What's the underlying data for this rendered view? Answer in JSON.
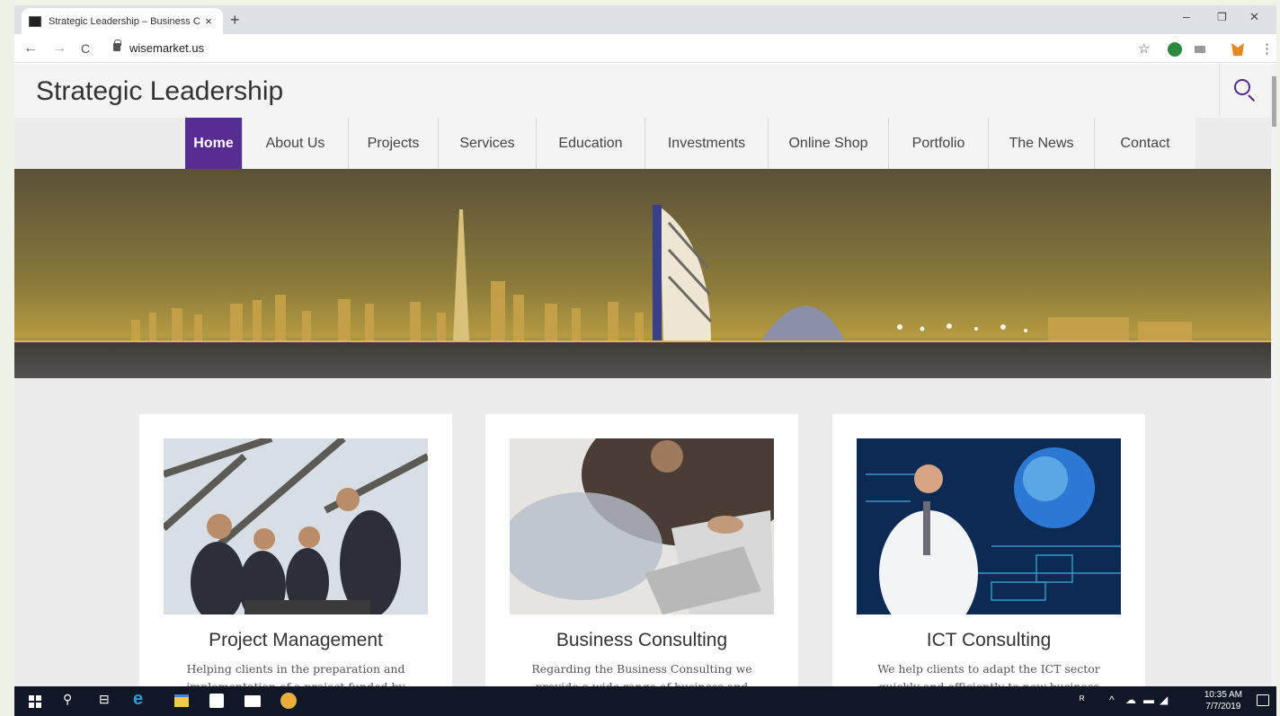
{
  "browser": {
    "tab_title": "Strategic Leadership – Business C",
    "tab_close": "×",
    "new_tab": "+",
    "window_controls": {
      "minimize": "–",
      "restore": "❐",
      "close": "✕"
    },
    "url": "wisemarket.us",
    "back": "←",
    "forward": "→",
    "reload": "C",
    "star": "☆",
    "menu": "⋮"
  },
  "site": {
    "title": "Strategic Leadership",
    "nav": [
      {
        "label": "Home",
        "active": true
      },
      {
        "label": "About Us"
      },
      {
        "label": "Projects"
      },
      {
        "label": "Services"
      },
      {
        "label": "Education"
      },
      {
        "label": "Investments"
      },
      {
        "label": "Online Shop"
      },
      {
        "label": "Portfolio"
      },
      {
        "label": "The News"
      },
      {
        "label": "Contact"
      }
    ],
    "accent": "#572d91"
  },
  "cards": [
    {
      "title": "Project Management",
      "text": "Helping clients in the preparation and implementation of a project funded by"
    },
    {
      "title": "Business Consulting",
      "text": "Regarding the Business Consulting we provide a wide range of business and development"
    },
    {
      "title": "ICT Consulting",
      "text": "We help clients to adapt the ICT sector quickly and efficiently to new business requirements"
    }
  ],
  "taskbar": {
    "time": "10:35 AM",
    "date": "7/7/2019",
    "icons": [
      "windows-icon",
      "search-icon",
      "task-view-icon",
      "edge-icon",
      "file-explorer-icon",
      "store-icon",
      "mail-icon",
      "chrome-canary-icon"
    ]
  }
}
